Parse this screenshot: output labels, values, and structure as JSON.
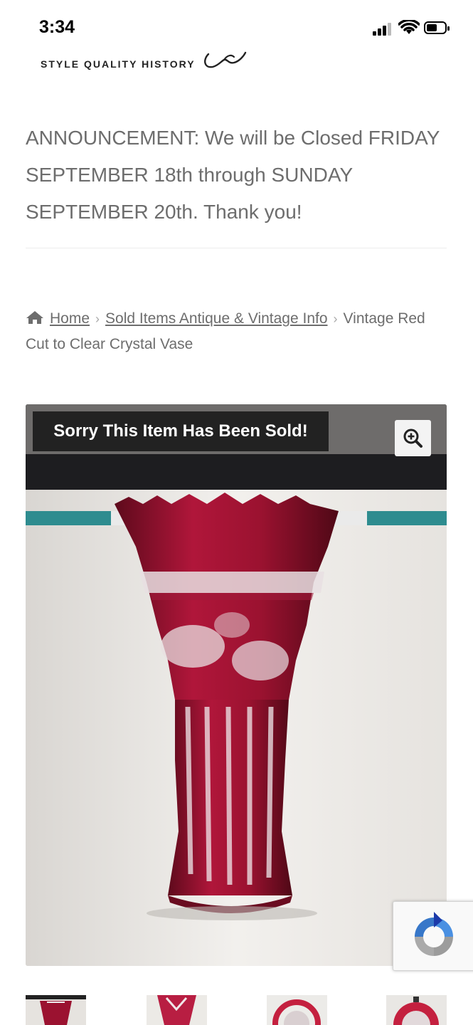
{
  "status_bar": {
    "time": "3:34"
  },
  "header": {
    "tagline": "STYLE QUALITY HISTORY"
  },
  "announcement": {
    "text": "ANNOUNCEMENT: We will be Closed FRIDAY SEPTEMBER 18th through SUNDAY SEPTEMBER 20th. Thank you!"
  },
  "breadcrumb": {
    "home": "Home",
    "category": "Sold Items Antique & Vintage Info",
    "current": "Vintage Red Cut to Clear Crystal Vase"
  },
  "product": {
    "sold_label": "Sorry This Item Has Been Sold!"
  },
  "icons": [
    "home-icon",
    "zoom-in-icon",
    "recaptcha-icon",
    "signal-icon",
    "wifi-icon",
    "battery-icon"
  ],
  "colors": {
    "text": "#6d6d6d",
    "banner_bg": "#222222",
    "vase_red": "#9b1230"
  }
}
